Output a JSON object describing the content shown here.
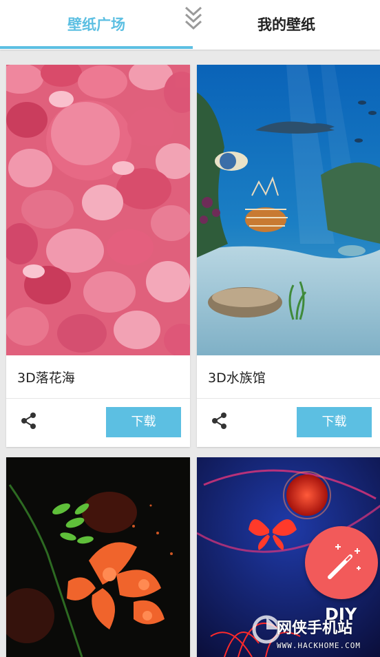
{
  "tabs": {
    "gallery_label": "壁纸广场",
    "mine_label": "我的壁纸"
  },
  "cards": [
    {
      "title": "3D落花海",
      "download_label": "下载"
    },
    {
      "title": "3D水族馆",
      "download_label": "下载"
    }
  ],
  "fab": {
    "label": "DIY"
  },
  "watermark": {
    "brand": "网侠手机站",
    "url": "WWW.HACKHOME.COM"
  },
  "colors": {
    "accent": "#5cbfe2",
    "fab": "#f25a5a",
    "background": "#e9e9e9"
  },
  "icons": {
    "expand": "chevron-double-down-icon",
    "share": "share-icon",
    "fab": "magic-wand-icon"
  }
}
